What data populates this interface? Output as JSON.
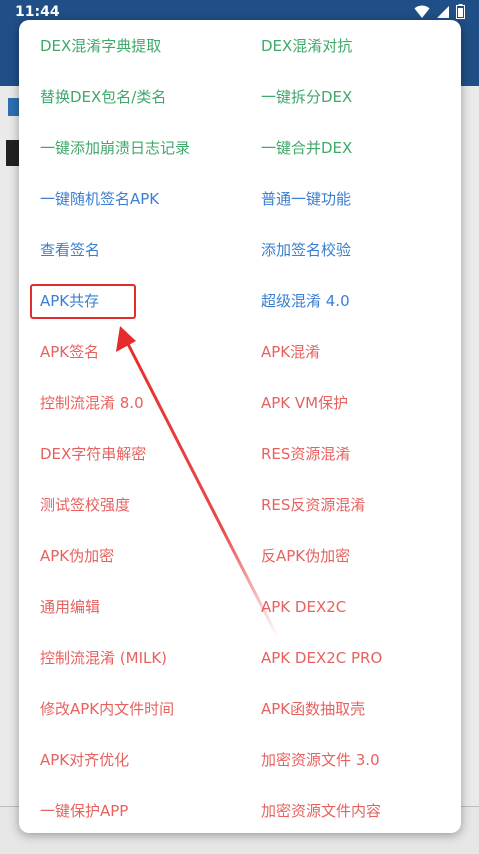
{
  "status": {
    "time": "11:44"
  },
  "menu": {
    "rows": [
      {
        "left": "DEX混淆字典提取",
        "right": "DEX混淆对抗"
      },
      {
        "left": "替换DEX包名/类名",
        "right": "一键拆分DEX"
      },
      {
        "left": "一键添加崩溃日志记录",
        "right": "一键合并DEX"
      },
      {
        "left": "一键随机签名APK",
        "right": "普通一键功能"
      },
      {
        "left": "查看签名",
        "right": "添加签名校验"
      },
      {
        "left": "APK共存",
        "right": "超级混淆 4.0"
      },
      {
        "left": "APK签名",
        "right": "APK混淆"
      },
      {
        "left": "控制流混淆 8.0",
        "right": "APK VM保护"
      },
      {
        "left": "DEX字符串解密",
        "right": "RES资源混淆"
      },
      {
        "left": "测试签校强度",
        "right": "RES反资源混淆"
      },
      {
        "left": "APK伪加密",
        "right": "反APK伪加密"
      },
      {
        "left": "通用编辑",
        "right": "APK DEX2C"
      },
      {
        "left": "控制流混淆 (MILK)",
        "right": "APK DEX2C PRO"
      },
      {
        "left": "修改APK内文件时间",
        "right": "APK函数抽取壳"
      },
      {
        "left": "APK对齐优化",
        "right": "加密资源文件 3.0"
      },
      {
        "left": "一键保护APP",
        "right": "加密资源文件内容"
      }
    ]
  },
  "colors": {
    "green": "#3fa86a",
    "blue": "#3a7fd0",
    "red": "#e6625f",
    "annotation": "#e52b2b",
    "statusbar": "#1f4f86"
  }
}
